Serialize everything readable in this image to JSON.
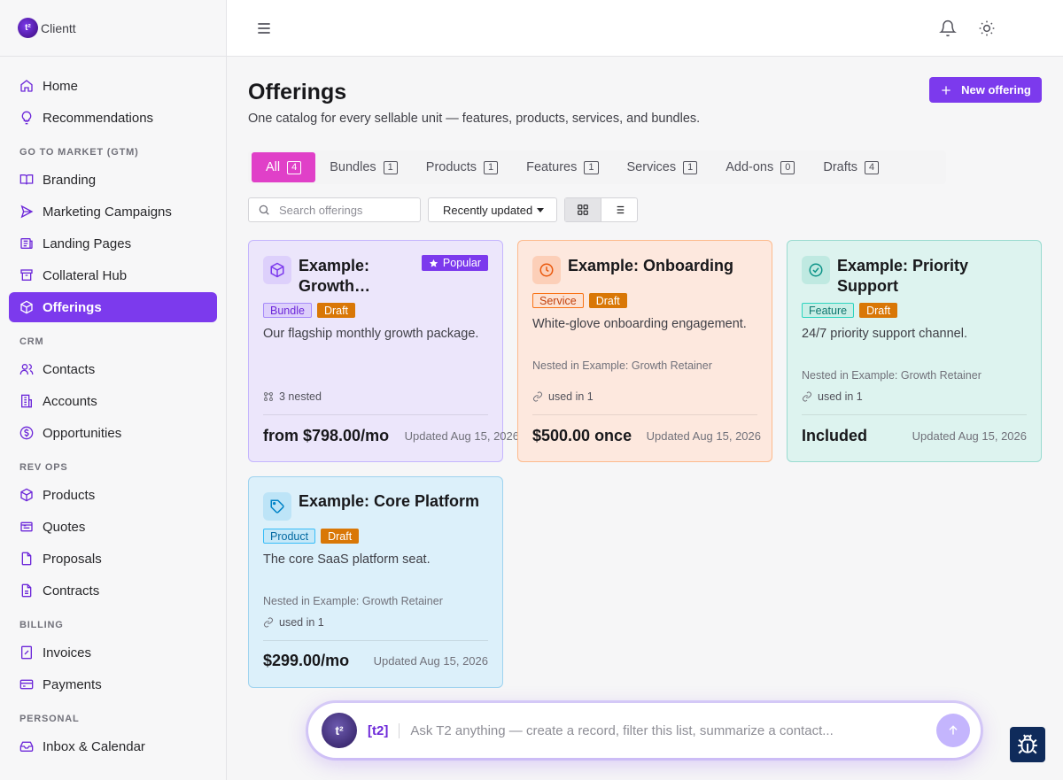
{
  "brand": {
    "name": "Clientt",
    "logo_glyph": "t²"
  },
  "sidebar": {
    "top": [
      {
        "label": "Home",
        "icon": "home-icon"
      },
      {
        "label": "Recommendations",
        "icon": "lightbulb-icon"
      }
    ],
    "sections": [
      {
        "title": "GO TO MARKET (GTM)",
        "items": [
          {
            "label": "Branding",
            "icon": "book-icon"
          },
          {
            "label": "Marketing Campaigns",
            "icon": "send-icon"
          },
          {
            "label": "Landing Pages",
            "icon": "newspaper-icon"
          },
          {
            "label": "Collateral Hub",
            "icon": "archive-icon"
          },
          {
            "label": "Offerings",
            "icon": "package-icon",
            "active": true
          }
        ]
      },
      {
        "title": "CRM",
        "items": [
          {
            "label": "Contacts",
            "icon": "users-icon"
          },
          {
            "label": "Accounts",
            "icon": "building-icon"
          },
          {
            "label": "Opportunities",
            "icon": "dollar-circle-icon"
          }
        ]
      },
      {
        "title": "REV OPS",
        "items": [
          {
            "label": "Products",
            "icon": "package-icon"
          },
          {
            "label": "Quotes",
            "icon": "quote-icon"
          },
          {
            "label": "Proposals",
            "icon": "file-icon"
          },
          {
            "label": "Contracts",
            "icon": "file-text-icon"
          }
        ]
      },
      {
        "title": "BILLING",
        "items": [
          {
            "label": "Invoices",
            "icon": "receipt-icon"
          },
          {
            "label": "Payments",
            "icon": "credit-card-icon"
          }
        ]
      },
      {
        "title": "PERSONAL",
        "items": [
          {
            "label": "Inbox & Calendar",
            "icon": "inbox-icon"
          }
        ]
      }
    ]
  },
  "header": {
    "title": "Offerings",
    "subtitle": "One catalog for every sellable unit — features, products, services, and bundles.",
    "new_button": "New offering"
  },
  "tabs": [
    {
      "label": "All",
      "count": "4",
      "active": true
    },
    {
      "label": "Bundles",
      "count": "1"
    },
    {
      "label": "Products",
      "count": "1"
    },
    {
      "label": "Features",
      "count": "1"
    },
    {
      "label": "Services",
      "count": "1"
    },
    {
      "label": "Add-ons",
      "count": "0"
    },
    {
      "label": "Drafts",
      "count": "4"
    }
  ],
  "toolbar": {
    "search_placeholder": "Search offerings",
    "sort_label": "Recently updated"
  },
  "cards": [
    {
      "title": "Example: Growth…",
      "badge_popular": "Popular",
      "type": "Bundle",
      "status": "Draft",
      "description": "Our flagship monthly growth package.",
      "meta": "3 nested",
      "price": "from $798.00/mo",
      "updated": "Updated Aug 15, 2026",
      "accent": "#7c3aed"
    },
    {
      "title": "Example: Onboarding",
      "type": "Service",
      "status": "Draft",
      "description": "White-glove onboarding engagement.",
      "nested": "Nested in Example: Growth Retainer",
      "used": "used in 1",
      "price": "$500.00 once",
      "updated": "Updated Aug 15, 2026",
      "accent": "#ea580c"
    },
    {
      "title_line1": "Example: Priority",
      "title_line2": "Support",
      "type": "Feature",
      "status": "Draft",
      "description": "24/7 priority support channel.",
      "nested": "Nested in Example: Growth Retainer",
      "used": "used in 1",
      "price": "Included",
      "updated": "Updated Aug 15, 2026",
      "accent": "#0d9488"
    },
    {
      "title": "Example: Core Platform",
      "type": "Product",
      "status": "Draft",
      "description": "The core SaaS platform seat.",
      "nested": "Nested in Example: Growth Retainer",
      "used": "used in 1",
      "price": "$299.00/mo",
      "updated": "Updated Aug 15, 2026",
      "accent": "#0284c7"
    }
  ],
  "chat": {
    "avatar_glyph": "t²",
    "tag": "[t2]",
    "placeholder": "Ask T2 anything — create a record, filter this list, summarize a contact..."
  }
}
